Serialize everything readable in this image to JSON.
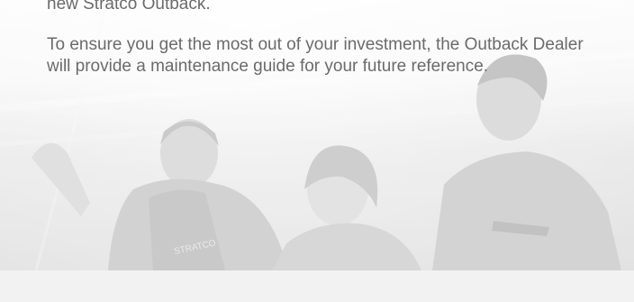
{
  "content": {
    "paragraph_1": "new Stratco Outback.",
    "paragraph_2": "To ensure you get the most out of your investment, the Outback Dealer will provide a maintenance guide for your future reference."
  },
  "photo": {
    "shirt_logo_text": "STRATCO"
  },
  "colors": {
    "text": "#6b6b6b",
    "background": "#ececec",
    "bottom_band": "#f2f2f2"
  }
}
